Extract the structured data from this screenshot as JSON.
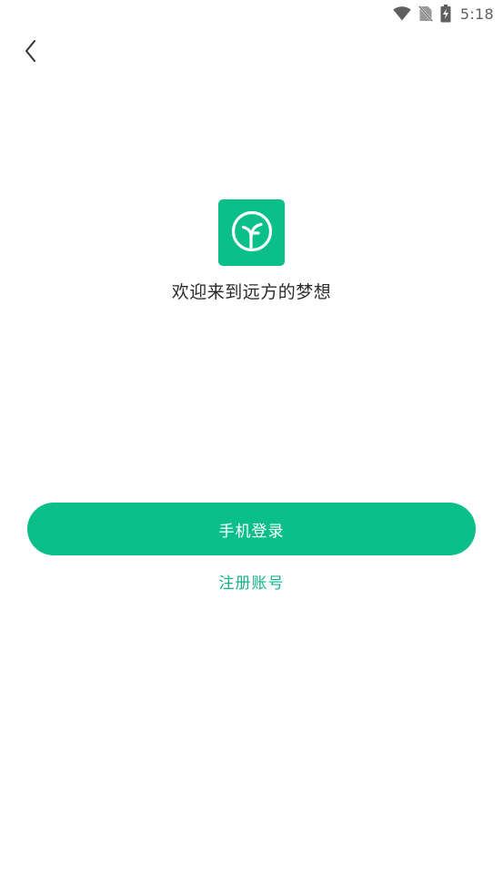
{
  "status_bar": {
    "time": "5:18",
    "icons": [
      "wifi-icon",
      "no-sim-icon",
      "battery-charging-icon"
    ]
  },
  "nav": {
    "back_icon": "chevron-left-icon"
  },
  "welcome": {
    "logo_icon": "sprout-icon",
    "text": "欢迎来到远方的梦想"
  },
  "actions": {
    "phone_login_label": "手机登录",
    "register_label": "注册账号"
  },
  "colors": {
    "primary": "#0abf8a",
    "link": "#17b289",
    "text": "#2b2b2b",
    "background": "#ffffff"
  }
}
